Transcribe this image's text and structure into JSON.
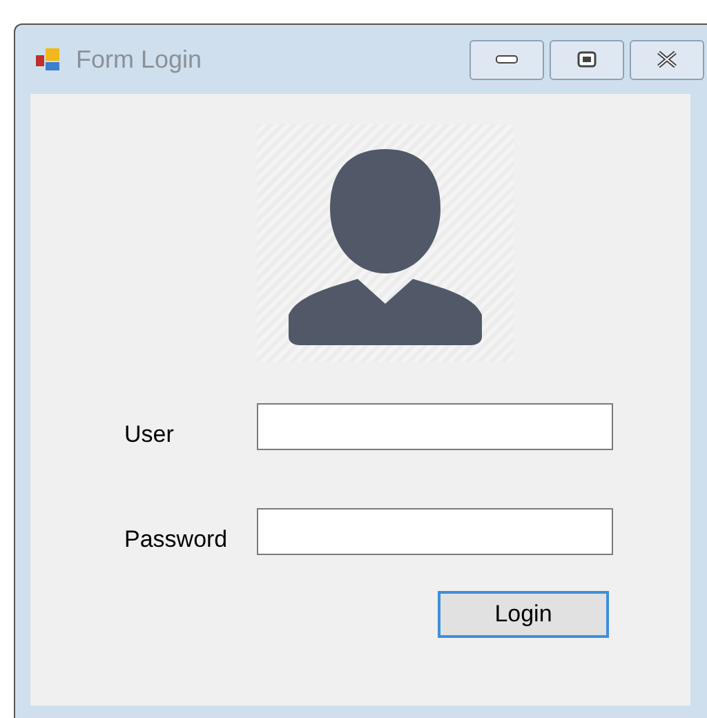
{
  "window": {
    "title": "Form Login"
  },
  "fields": [
    {
      "label": "User"
    },
    {
      "label": "Password"
    }
  ],
  "login_button": {
    "label": "Login",
    "focused": true
  }
}
